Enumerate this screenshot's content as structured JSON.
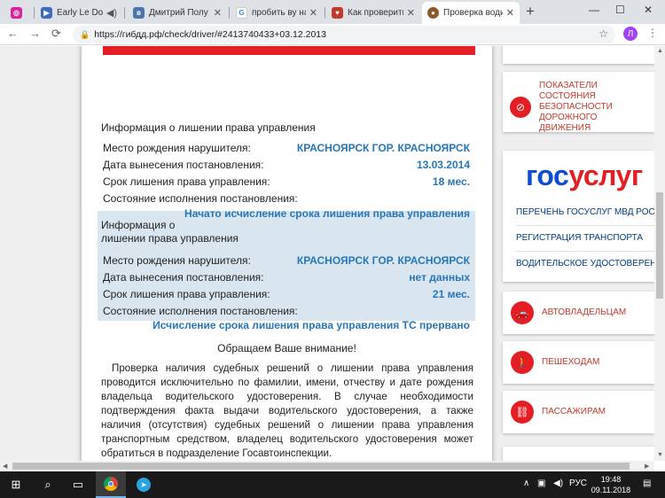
{
  "browser": {
    "tabs": [
      {
        "icon": "instagram-icon",
        "title": "",
        "color": "#d6249f"
      },
      {
        "icon": "youtube-icon",
        "title": "Early Le Do",
        "color": "#3d6bbf"
      },
      {
        "icon": "vk-icon",
        "title": "Дмитрий Полу",
        "color": "#4a76a8"
      },
      {
        "icon": "google-icon",
        "title": "пробить ву на",
        "color": "#4285f4"
      },
      {
        "icon": "site-icon",
        "title": "Как проверить",
        "color": "#c0392b"
      },
      {
        "icon": "gibdd-icon",
        "title": "Проверка води",
        "color": "#8b5a2b",
        "active": true
      }
    ],
    "url": "https://гибдд.рф/check/driver/#2413740433+03.12.2013",
    "profile_initial": "Л"
  },
  "main": {
    "deprivation_1": {
      "heading": "Информация о лишении права управления",
      "rows": [
        {
          "label": "Место рождения нарушителя:",
          "value": "КРАСНОЯРСК ГОР. КРАСНОЯРСК"
        },
        {
          "label": "Дата вынесения постановления:",
          "value": "13.03.2014"
        },
        {
          "label": "Срок лишения права управления:",
          "value": "18 мес."
        },
        {
          "label": "Состояние исполнения постановления:",
          "value": ""
        }
      ],
      "status": "Начато исчисление срока лишения права управления"
    },
    "deprivation_2": {
      "heading_line1": "Информация о",
      "heading_line2": "лишении права управления",
      "rows": [
        {
          "label": "Место рождения нарушителя:",
          "value": "КРАСНОЯРСК ГОР. КРАСНОЯРСК"
        },
        {
          "label": "Дата вынесения постановления:",
          "value": "нет данных"
        },
        {
          "label": "Срок лишения права управления:",
          "value": "21 мес."
        },
        {
          "label": "Состояние исполнения постановления:",
          "value": ""
        }
      ],
      "status": "Исчисление срока лишения права управления ТС прервано"
    },
    "notice_title": "Обращаем Ваше внимание!",
    "notice_text": "Проверка наличия судебных решений о лишении права управления проводится исключительно по фамилии, имени, отчеству и дате рождения владельца водительского удостоверения. В случае необходимости подтверждения факта выдачи водительского удостоверения, а также наличия (отсутствия) судебных решений о лишении права управления транспортным средством, владелец водительского удостоверения может обратиться в подразделение Госавтоинспекции."
  },
  "sidebar": {
    "safety_link": "ПОКАЗАТЕЛИ СОСТОЯНИЯ БЕЗОПАСНОСТИ ДОРОЖНОГО ДВИЖЕНИЯ",
    "gosuslugi": {
      "logo_part1": "гос",
      "logo_part2": "услуг",
      "links": [
        "ПЕРЕЧЕНЬ ГОСУСЛУГ МВД РОССИИ",
        "РЕГИСТРАЦИЯ ТРАНСПОРТА",
        "ВОДИТЕЛЬСКОЕ УДОСТОВЕРЕНИЕ"
      ]
    },
    "audience": [
      {
        "label": "АВТОВЛАДЕЛЬЦАМ",
        "icon": "car-icon"
      },
      {
        "label": "ПЕШЕХОДАМ",
        "icon": "pedestrian-icon"
      },
      {
        "label": "ПАССАЖИРАМ",
        "icon": "seatbelt-icon"
      }
    ]
  },
  "taskbar": {
    "lang": "РУС",
    "time": "19:48",
    "date": "09.11.2018"
  },
  "colors": {
    "accent_red": "#e31e24",
    "value_blue": "#2776b8",
    "highlight_bg": "#d9e6ef",
    "gos_blue": "#0d4cd3"
  }
}
